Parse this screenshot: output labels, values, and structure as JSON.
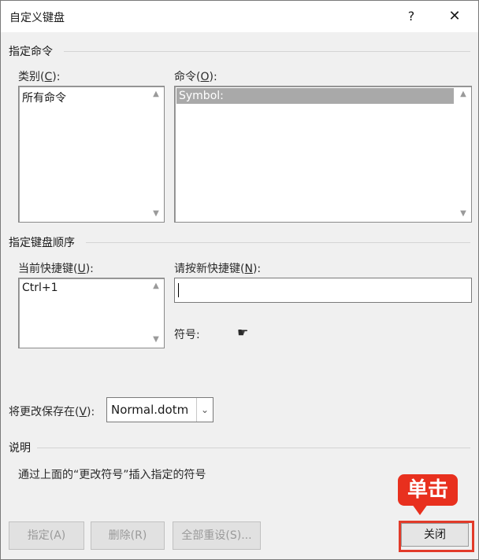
{
  "window": {
    "title": "自定义键盘",
    "help": "?",
    "close": "✕"
  },
  "assign_command": {
    "section_title": "指定命令",
    "category": {
      "label": "类别(",
      "hotkey": "C",
      "label_end": "):",
      "items": [
        "所有命令"
      ]
    },
    "command": {
      "label": "命令(",
      "hotkey": "O",
      "label_end": "):",
      "selected": "Symbol:"
    }
  },
  "key_sequence": {
    "section_title": "指定键盘顺序",
    "current_keys": {
      "label": "当前快捷键(",
      "hotkey": "U",
      "label_end": "):",
      "items": [
        "Ctrl+1"
      ]
    },
    "new_key": {
      "label": "请按新快捷键(",
      "hotkey": "N",
      "label_end": "):",
      "value": ""
    },
    "symbol": {
      "label": "符号:",
      "preview": "☛"
    }
  },
  "save_in": {
    "label": "将更改保存在(",
    "hotkey": "V",
    "label_end": "):",
    "value": "Normal.dotm"
  },
  "description": {
    "section_title": "说明",
    "text": "通过上面的“更改符号”插入指定的符号"
  },
  "buttons": {
    "assign": "指定(A)",
    "remove": "删除(R)",
    "reset_all": "全部重设(S)...",
    "close": "关闭"
  },
  "annotation": {
    "callout": "单击",
    "color": "#e8301e"
  }
}
